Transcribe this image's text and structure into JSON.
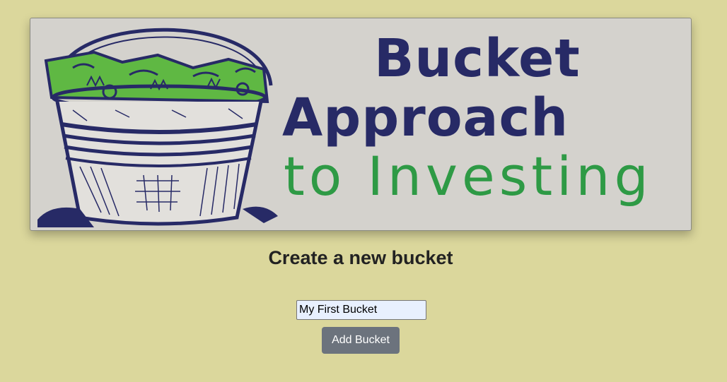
{
  "banner": {
    "title_line1": "Bucket",
    "title_line2": "Approach",
    "subtitle": "to Investing",
    "colors": {
      "background": "#d4d2cd",
      "title": "#272a66",
      "subtitle": "#2e9a45",
      "money": "#5fb843"
    }
  },
  "form": {
    "heading": "Create a new bucket",
    "bucket_name_value": "My First Bucket",
    "add_button_label": "Add Bucket"
  },
  "theme": {
    "page_background": "#dbd79c",
    "button_background": "#6c737d",
    "input_background": "#e8f0fe"
  }
}
